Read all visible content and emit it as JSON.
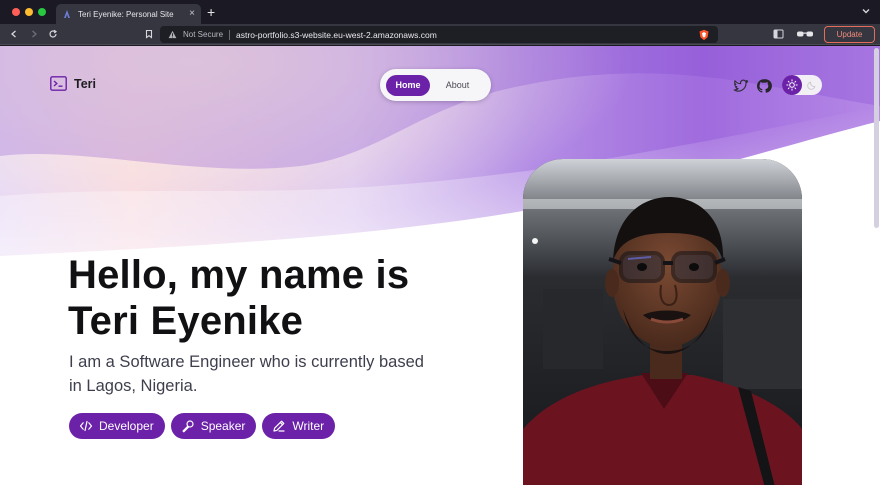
{
  "browser": {
    "tab_title": "Teri Eyenike: Personal Site",
    "security_label": "Not Secure",
    "url": "astro-portfolio.s3-website.eu-west-2.amazonaws.com",
    "update_label": "Update"
  },
  "site": {
    "logo_text": "Teri",
    "nav": {
      "home": "Home",
      "about": "About"
    },
    "headline_line1": "Hello, my name is",
    "headline_line2": "Teri Eyenike",
    "subheading_line1": "I am a Software Engineer who is currently based",
    "subheading_line2": "in Lagos, Nigeria.",
    "roles": [
      {
        "label": "Developer",
        "icon": "code-icon"
      },
      {
        "label": "Speaker",
        "icon": "microphone-icon"
      },
      {
        "label": "Writer",
        "icon": "pen-icon"
      }
    ]
  },
  "colors": {
    "accent": "#6b21a8",
    "chrome_bg": "#35363f",
    "update_border": "#e36c5d"
  }
}
